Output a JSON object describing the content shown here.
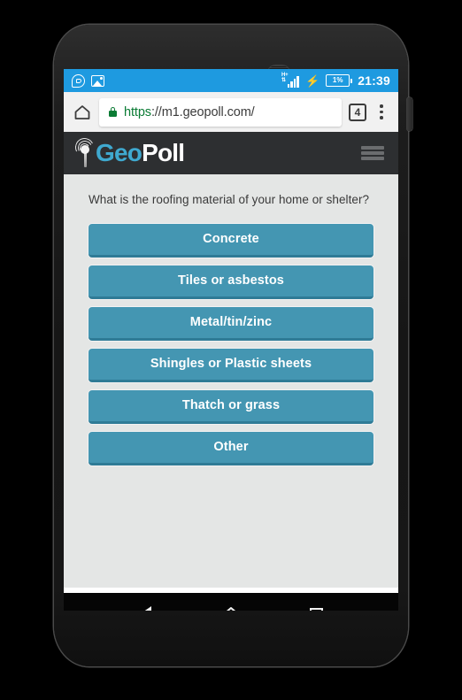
{
  "status_bar": {
    "icons": [
      "whatsapp-icon",
      "photo-icon"
    ],
    "network_label": "H+",
    "battery_percent": "1%",
    "charging": true,
    "time": "21:39",
    "background_color": "#1e9ae0"
  },
  "browser": {
    "home_icon": "home-icon",
    "lock_icon": "lock-icon",
    "url_scheme": "https",
    "url_rest": "://m1.geopoll.com/",
    "tab_count": "4",
    "menu_icon": "kebab-menu-icon"
  },
  "site_header": {
    "logo_mark": "signal-antenna-icon",
    "logo_geo": "Geo",
    "logo_poll": "Poll",
    "menu_icon": "hamburger-menu-icon",
    "background_color": "#2d2f31",
    "accent_color": "#3fa9cf"
  },
  "poll": {
    "question": "What is the roofing material of your home or shelter?",
    "option_color": "#4496b2",
    "options": [
      {
        "label": "Concrete"
      },
      {
        "label": "Tiles or asbestos"
      },
      {
        "label": "Metal/tin/zinc"
      },
      {
        "label": "Shingles or Plastic sheets"
      },
      {
        "label": "Thatch or grass"
      },
      {
        "label": "Other"
      }
    ]
  },
  "nav_bar": {
    "back": "back-triangle-icon",
    "home": "home-pentagon-icon",
    "recents": "recents-square-icon"
  }
}
